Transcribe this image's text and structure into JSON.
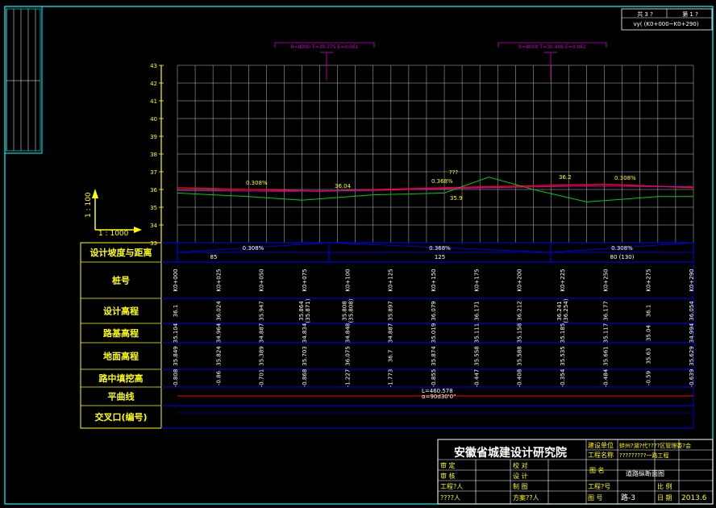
{
  "title_block_top": {
    "sheet": "共 3 ?",
    "page": "第 1 ?",
    "range": "vy( (K0+000~K0+290)"
  },
  "chart_data": {
    "type": "line",
    "ylim": [
      33,
      43
    ],
    "yticks": [
      "43",
      "42",
      "41",
      "40",
      "39",
      "38",
      "37",
      "36",
      "35",
      "34",
      "33"
    ],
    "scale_v": "1 : 100",
    "scale_h": "1 : 1000",
    "x": [
      0,
      290
    ],
    "series": [
      {
        "color": "#ff0000",
        "points": [
          [
            0,
            36.1
          ],
          [
            80,
            35.9
          ],
          [
            150,
            36.1
          ],
          [
            240,
            36.3
          ],
          [
            290,
            36.1
          ]
        ]
      },
      {
        "color": "#00cc00",
        "points": [
          [
            0,
            35.8
          ],
          [
            40,
            35.6
          ],
          [
            70,
            35.4
          ],
          [
            110,
            35.7
          ],
          [
            150,
            35.8
          ],
          [
            175,
            36.7
          ],
          [
            200,
            36.0
          ],
          [
            230,
            35.3
          ],
          [
            270,
            35.6
          ],
          [
            290,
            35.6
          ]
        ]
      },
      {
        "color": "#cc00cc",
        "points": [
          [
            0,
            35.95
          ],
          [
            60,
            35.9
          ],
          [
            110,
            35.95
          ],
          [
            175,
            36.1
          ],
          [
            230,
            36.2
          ],
          [
            290,
            36.15
          ]
        ]
      }
    ],
    "annotations": [
      "0.308%",
      "36.04",
      "0.368%",
      "???",
      "35.9",
      "36.2",
      "0.308%"
    ],
    "curves": [
      "R=8000 T=30.375 E=0.061",
      "R=8000 T=30.406 E=0.061"
    ]
  },
  "grade_row": {
    "values": [
      "0.308%",
      "0.368%",
      "0.308%"
    ],
    "lengths": [
      "85",
      "125",
      "80 (130)"
    ]
  },
  "row_labels": [
    "设计坡度与距离",
    "桩号",
    "设计高程",
    "路基高程",
    "地面高程",
    "路中填挖高",
    "平曲线",
    "交叉口(编号)"
  ],
  "stations": [
    "K0+000",
    "K0+025",
    "K0+050",
    "K0+075",
    "K0+100",
    "K0+125",
    "K0+150",
    "K0+175",
    "K0+200",
    "K0+225",
    "K0+250",
    "K0+275",
    "K0+290"
  ],
  "design_elev": [
    "36.1",
    "36.024",
    "35.947",
    "35.864\n(35.871)",
    "35.808\n(35.808)",
    "35.897",
    "36.079",
    "36.171",
    "36.212",
    "36.241\n(36.254)",
    "36.177",
    "36.1",
    "36.054"
  ],
  "subgrade_elev": [
    "35.104",
    "34.964",
    "34.887",
    "34.834",
    "34.848",
    "34.887",
    "35.019",
    "35.111",
    "35.158",
    "35.185",
    "35.117",
    "35.04",
    "34.994"
  ],
  "ground_elev": [
    "35.849",
    "35.824",
    "35.389",
    "35.703",
    "36.075",
    "36.7",
    "35.874",
    "35.558",
    "35.588",
    "35.535",
    "35.661",
    "35.63",
    "35.629"
  ],
  "cut_fill": [
    "-0.808",
    "-0.86",
    "-0.701",
    "-0.868",
    "-1.227",
    "-1.773",
    "-0.855",
    "-0.447",
    "-0.408",
    "-0.354",
    "-0.484",
    "-0.59",
    "-0.639"
  ],
  "horizontal_curve": "L=460.578\nα=90d30'0\"",
  "title_block": {
    "institute": "安徽省城建设计研究院",
    "owner_label": "建设单位",
    "owner_value": "蚌州?湖?代????区管理委?会",
    "project_label": "工程名称",
    "project_value": "?????????一路工程",
    "row1_left": "审  定",
    "row1_mid": "校  对",
    "row2_left": "审  核",
    "row2_mid": "设  计",
    "row3_left": "工程?人",
    "row3_mid": "制  图",
    "row4_left": "????人",
    "row4_mid": "方案??人",
    "drawing_name_label": "图  名",
    "drawing_name_value": "道路纵断面图",
    "project_no_label": "工程?号",
    "scale_label": "比  例",
    "drawing_no_label": "图  号",
    "drawing_no_value": "路-3",
    "date_label": "日  期",
    "date_value": "2013.6"
  }
}
